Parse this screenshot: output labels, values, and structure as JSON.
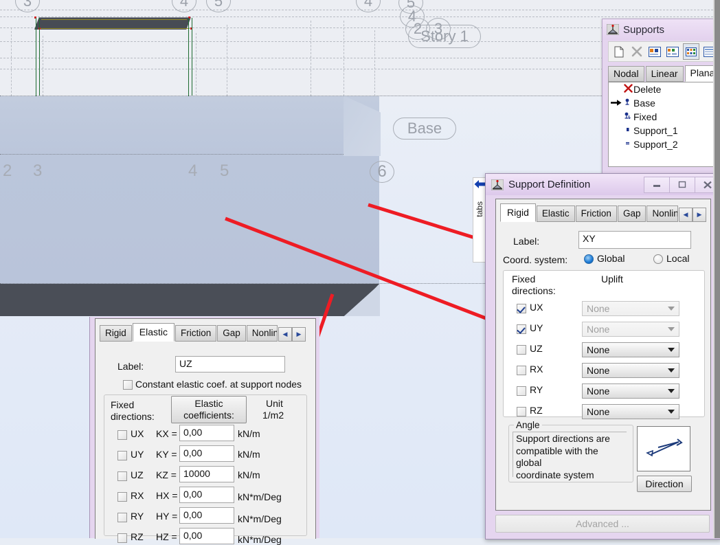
{
  "viewport": {
    "name": "3d-model-viewport",
    "story_label": "Story 1",
    "base_label": "Base",
    "top_bubbles": [
      "3",
      "4",
      "5"
    ],
    "stacked_bubbles": [
      "5",
      "4",
      "2",
      "3"
    ],
    "axis_numbers": [
      "2",
      "3",
      "4",
      "5",
      "6"
    ],
    "annotation_color": "#ee1c24"
  },
  "supports_panel": {
    "title": "Supports",
    "icon": "support-symbol-icon",
    "toolbar": [
      {
        "name": "new-icon",
        "glyph": "⬜"
      },
      {
        "name": "delete-icon",
        "glyph": "✕"
      },
      {
        "name": "large-icons-icon",
        "glyph": ""
      },
      {
        "name": "small-icons-icon",
        "glyph": ""
      },
      {
        "name": "list-icon",
        "glyph": ""
      },
      {
        "name": "details-icon",
        "glyph": ""
      }
    ],
    "tabs": [
      {
        "label": "Nodal",
        "active": false
      },
      {
        "label": "Linear",
        "active": false
      },
      {
        "label": "Planar",
        "active": true
      }
    ],
    "items": [
      {
        "label": "Delete",
        "icon": "red-x-icon",
        "selected": false
      },
      {
        "label": "Base",
        "icon": "support-icon",
        "selected": true
      },
      {
        "label": "Fixed",
        "icon": "support-icon",
        "selected": false
      },
      {
        "label": "Support_1",
        "icon": "support-icon",
        "selected": false
      },
      {
        "label": "Support_2",
        "icon": "support-icon",
        "selected": false
      }
    ]
  },
  "support_definition": {
    "title": "Support Definition",
    "icon": "support-symbol-icon",
    "window_buttons": [
      {
        "name": "minimize-button",
        "glyph": "—"
      },
      {
        "name": "maximize-button",
        "glyph": "□"
      },
      {
        "name": "close-button",
        "glyph": "✕"
      }
    ],
    "tabs": [
      {
        "label": "Rigid",
        "active": true
      },
      {
        "label": "Elastic",
        "active": false
      },
      {
        "label": "Friction",
        "active": false
      },
      {
        "label": "Gap",
        "active": false
      },
      {
        "label": "Nonlinea",
        "active": false
      }
    ],
    "scroll_left_glyph": "◀",
    "scroll_right_glyph": "▶",
    "label_caption": "Label:",
    "label_value": "XY",
    "coord_caption": "Coord. system:",
    "coord_options": [
      {
        "label": "Global",
        "selected": true
      },
      {
        "label": "Local",
        "selected": false
      }
    ],
    "fixed_directions_caption": "Fixed\ndirections:",
    "fixed_directions_caption_l1": "Fixed",
    "fixed_directions_caption_l2": "directions:",
    "uplift_caption": "Uplift",
    "directions": [
      {
        "label": "UX",
        "checked": true,
        "uplift": "None",
        "uplift_enabled": false
      },
      {
        "label": "UY",
        "checked": true,
        "uplift": "None",
        "uplift_enabled": false
      },
      {
        "label": "UZ",
        "checked": false,
        "uplift": "None",
        "uplift_enabled": true
      },
      {
        "label": "RX",
        "checked": false,
        "uplift": "None",
        "uplift_enabled": true
      },
      {
        "label": "RY",
        "checked": false,
        "uplift": "None",
        "uplift_enabled": true
      },
      {
        "label": "RZ",
        "checked": false,
        "uplift": "None",
        "uplift_enabled": true
      }
    ],
    "angle_group_title": "Angle",
    "angle_text_l1": "Support directions are",
    "angle_text_l2": "compatible with the global",
    "angle_text_l3": "coordinate system",
    "direction_button": "Direction",
    "direction_preview_icon": "angle-direction-icon",
    "advanced_button": "Advanced ...",
    "advanced_enabled": false
  },
  "elastic_dialog": {
    "tabs": [
      {
        "label": "Rigid",
        "active": false
      },
      {
        "label": "Elastic",
        "active": true
      },
      {
        "label": "Friction",
        "active": false
      },
      {
        "label": "Gap",
        "active": false
      },
      {
        "label": "Nonlinea",
        "active": false
      }
    ],
    "scroll_left_glyph": "◀",
    "scroll_right_glyph": "▶",
    "label_caption": "Label:",
    "label_value": "UZ",
    "constant_checkbox_label": "Constant elastic coef. at support nodes",
    "constant_checked": false,
    "fixed_caption_l1": "Fixed",
    "fixed_caption_l2": "directions:",
    "coefficients_button_l1": "Elastic",
    "coefficients_button_l2": "coefficients:",
    "unit_caption_l1": "Unit",
    "unit_caption_l2": "1/m2",
    "rows": [
      {
        "dir": "UX",
        "checked": false,
        "k_label": "KX =",
        "value": "0,00",
        "unit": "kN/m"
      },
      {
        "dir": "UY",
        "checked": false,
        "k_label": "KY =",
        "value": "0,00",
        "unit": "kN/m"
      },
      {
        "dir": "UZ",
        "checked": false,
        "k_label": "KZ =",
        "value": "10000",
        "unit": "kN/m"
      },
      {
        "dir": "RX",
        "checked": false,
        "k_label": "HX =",
        "value": "0,00",
        "unit": "kN*m/Deg"
      },
      {
        "dir": "RY",
        "checked": false,
        "k_label": "HY =",
        "value": "0,00",
        "unit": "kN*m/Deg"
      },
      {
        "dir": "RZ",
        "checked": false,
        "k_label": "HZ =",
        "value": "0,00",
        "unit": "kN*m/Deg"
      }
    ]
  },
  "side_tabstrip": {
    "label": "tabs",
    "arrow_icon": "left-arrow-icon"
  }
}
